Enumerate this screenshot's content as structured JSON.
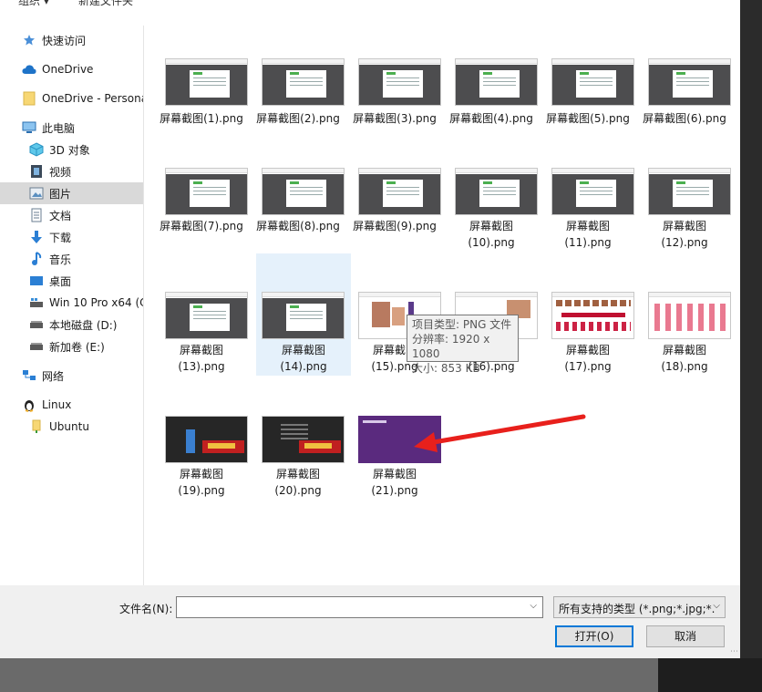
{
  "toolbar": {
    "organize_label": "组织 ▾",
    "new_folder_label": "新建文件夹"
  },
  "sidebar": {
    "items": [
      {
        "label": "快速访问",
        "icon": "star-icon"
      },
      {
        "label": "OneDrive",
        "icon": "cloud-icon"
      },
      {
        "label": "OneDrive - Persona",
        "icon": "folder-icon"
      },
      {
        "label": "此电脑",
        "icon": "computer-icon"
      },
      {
        "label": "3D 对象",
        "icon": "cube-icon"
      },
      {
        "label": "视频",
        "icon": "video-icon"
      },
      {
        "label": "图片",
        "icon": "pictures-icon"
      },
      {
        "label": "文档",
        "icon": "document-icon"
      },
      {
        "label": "下载",
        "icon": "download-icon"
      },
      {
        "label": "音乐",
        "icon": "music-icon"
      },
      {
        "label": "桌面",
        "icon": "desktop-icon"
      },
      {
        "label": "Win 10 Pro x64 (C",
        "icon": "drive-icon"
      },
      {
        "label": "本地磁盘 (D:)",
        "icon": "drive-icon"
      },
      {
        "label": "新加卷 (E:)",
        "icon": "drive-icon"
      },
      {
        "label": "网络",
        "icon": "network-icon"
      },
      {
        "label": "Linux",
        "icon": "linux-icon"
      },
      {
        "label": "Ubuntu",
        "icon": "folder-icon"
      }
    ]
  },
  "files": [
    {
      "line1": "屏幕截图(1).png",
      "line2": ""
    },
    {
      "line1": "屏幕截图(2).png",
      "line2": ""
    },
    {
      "line1": "屏幕截图(3).png",
      "line2": ""
    },
    {
      "line1": "屏幕截图(4).png",
      "line2": ""
    },
    {
      "line1": "屏幕截图(5).png",
      "line2": ""
    },
    {
      "line1": "屏幕截图(6).png",
      "line2": ""
    },
    {
      "line1": "屏幕截图(7).png",
      "line2": ""
    },
    {
      "line1": "屏幕截图(8).png",
      "line2": ""
    },
    {
      "line1": "屏幕截图(9).png",
      "line2": ""
    },
    {
      "line1": "屏幕截图",
      "line2": "(10).png"
    },
    {
      "line1": "屏幕截图",
      "line2": "(11).png"
    },
    {
      "line1": "屏幕截图",
      "line2": "(12).png"
    },
    {
      "line1": "屏幕截图",
      "line2": "(13).png"
    },
    {
      "line1": "屏幕截图",
      "line2": "(14).png"
    },
    {
      "line1": "屏幕截图",
      "line2": "(15).png"
    },
    {
      "line1": "屏幕截图",
      "line2": "(16).png"
    },
    {
      "line1": "屏幕截图",
      "line2": "(17).png"
    },
    {
      "line1": "屏幕截图",
      "line2": "(18).png"
    },
    {
      "line1": "屏幕截图",
      "line2": "(19).png"
    },
    {
      "line1": "屏幕截图",
      "line2": "(20).png"
    },
    {
      "line1": "屏幕截图",
      "line2": "(21).png"
    }
  ],
  "tooltip": {
    "type": "项目类型: PNG 文件",
    "resolution": "分辨率: 1920 x 1080",
    "size": "大小: 853 KB"
  },
  "bottom": {
    "filename_label": "文件名(N):",
    "filename_value": "",
    "filetype_value": "所有支持的类型 (*.png;*.jpg;*.",
    "open_label": "打开(O)",
    "cancel_label": "取消"
  },
  "colors": {
    "selection": "#d9d9d9",
    "hover": "#e5f1fb",
    "accent": "#0078d7",
    "arrow": "#e8201c"
  }
}
